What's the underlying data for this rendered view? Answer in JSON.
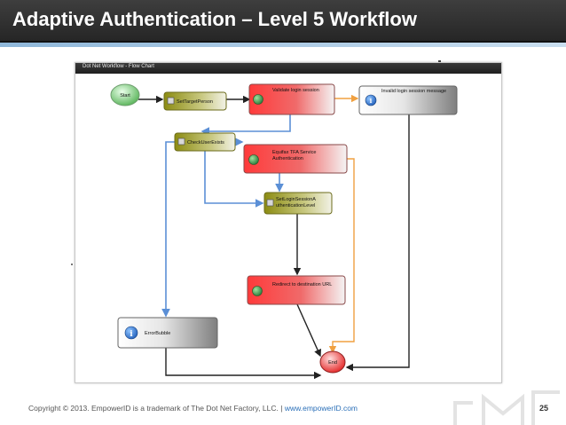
{
  "slide": {
    "title": "Adaptive Authentication – Level 5 Workflow",
    "frame_title": "Dot Net Workflow - Flow Chart",
    "page_number": "25"
  },
  "footer": {
    "copyright": "Copyright © 2013. EmpowerID is a trademark of The Dot Net Factory, LLC.",
    "separator": "|",
    "link": "www.empowerID.com"
  },
  "nodes": {
    "start": "Start",
    "set_target_person": "SetTargetPerson",
    "validate_login_session": "Validate login session",
    "invalid_login_session_message": "Invalid login session message",
    "check_user_exists": "CheckUserExists",
    "equifax_line1": "Equifax TFA Service",
    "equifax_line2": "Authentication",
    "set_login_line1": "SetLoginSessionA",
    "set_login_line2": "uthenticationLevel",
    "redirect": "Redirect to destination URL",
    "error_bubble": "ErrorBubble",
    "end": "End"
  },
  "colors": {
    "title_bar": "#2f2f2f",
    "connector_blue": "#5b8fd6",
    "connector_orange": "#f0a040",
    "connector_black": "#222222",
    "node_red": "#e62020",
    "node_olive": "#9a9a18",
    "node_gray": "#8a8a8a",
    "node_green": "#5cbf5c",
    "link": "#2a6fb8"
  },
  "icons": [
    "globe-icon",
    "info-icon",
    "workflow-icon"
  ]
}
